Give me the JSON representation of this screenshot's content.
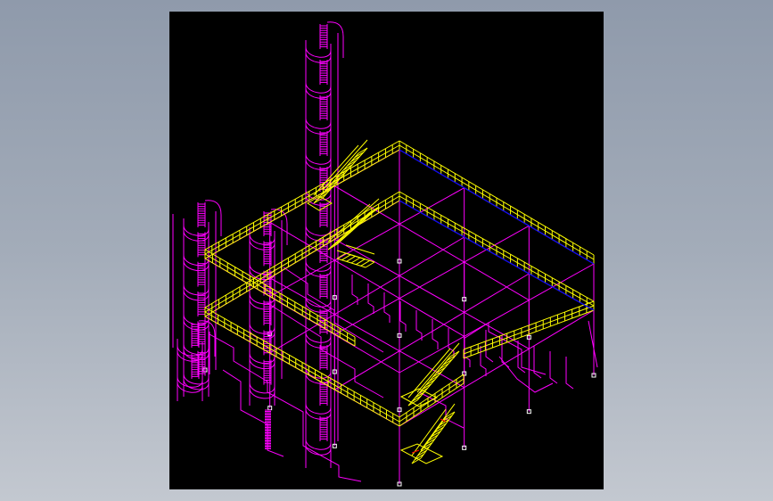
{
  "viewer": {
    "background": "#000000",
    "frame_background": "#9aa4b2"
  },
  "drawing": {
    "style": "isometric wireframe CAD drawing",
    "palette": {
      "structure": "#ff00ff",
      "railing": "#ffff00",
      "edge": "#0000ff",
      "marker": "#ff0000",
      "base_marker": "#ffffff"
    },
    "components": [
      "upper-platform-deck",
      "lower-platform-deck",
      "column-grid",
      "tall-tower-spiral-stair",
      "left-tower-spiral-stairs",
      "diagonal-stair-flights",
      "piping-runs"
    ]
  }
}
